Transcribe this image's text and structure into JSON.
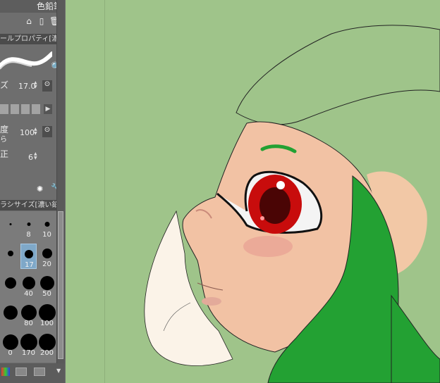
{
  "tool_name": "色鉛筆",
  "tool_property_header": "ールプロパティ[濃い鉛筆",
  "brush_size": {
    "label": "ズ",
    "value": "17.0"
  },
  "density": {
    "label_line1": "度",
    "label_line2": "ら",
    "value": "100"
  },
  "correction": {
    "label": "正",
    "value": "6"
  },
  "brush_size_header": "ラシサイズ[濃い鉛筆",
  "brush_sizes": [
    {
      "label": "",
      "size": 3
    },
    {
      "label": "8",
      "size": 5
    },
    {
      "label": "10",
      "size": 7
    },
    {
      "label": "",
      "size": 8
    },
    {
      "label": "17",
      "size": 12,
      "selected": true
    },
    {
      "label": "20",
      "size": 14
    },
    {
      "label": "",
      "size": 16
    },
    {
      "label": "40",
      "size": 18
    },
    {
      "label": "50",
      "size": 20
    },
    {
      "label": "",
      "size": 20
    },
    {
      "label": "80",
      "size": 22
    },
    {
      "label": "100",
      "size": 24
    },
    {
      "label": "0",
      "size": 22
    },
    {
      "label": "170",
      "size": 24
    },
    {
      "label": "200",
      "size": 24
    }
  ],
  "colors": {
    "canvas_bg": "#9fc48a",
    "hair": "#23a133",
    "skin": "#f2c2a4",
    "eye": "#d81010"
  }
}
